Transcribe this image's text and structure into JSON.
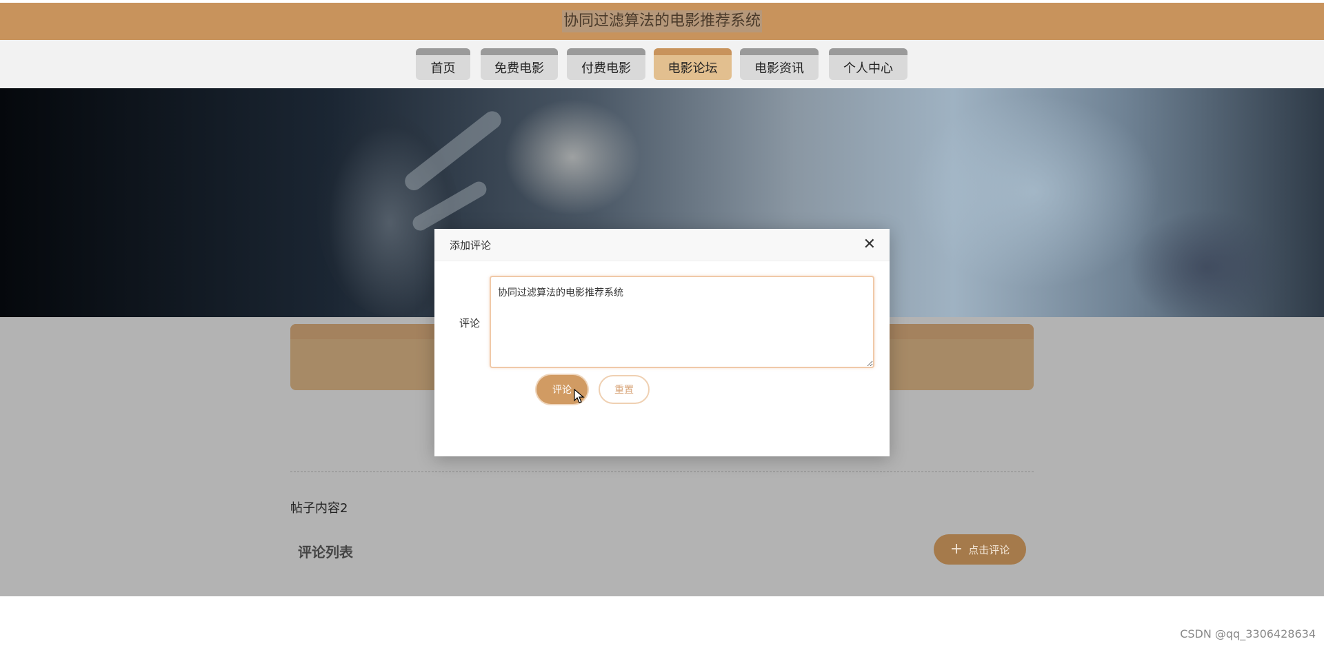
{
  "header": {
    "site_title": "协同过滤算法的电影推荐系统"
  },
  "nav": {
    "items": [
      {
        "label": "首页"
      },
      {
        "label": "免费电影"
      },
      {
        "label": "付费电影"
      },
      {
        "label": "电影论坛",
        "active": true
      },
      {
        "label": "电影资讯"
      },
      {
        "label": "个人中心"
      }
    ]
  },
  "main": {
    "post_content": "帖子内容2",
    "comments_title": "评论列表",
    "add_comment_label": "点击评论"
  },
  "modal": {
    "title": "添加评论",
    "comment_label": "评论",
    "comment_value": "协同过滤算法的电影推荐系统",
    "submit_label": "评论",
    "reset_label": "重置"
  },
  "watermark": "CSDN @qq_3306428634",
  "colors": {
    "accent": "#c8935c",
    "active_tab": "#e2bf8f",
    "submit_button": "#d19b63"
  },
  "icons": {
    "close": "close-icon",
    "plus": "plus-icon",
    "cursor": "mouse-cursor-icon"
  }
}
